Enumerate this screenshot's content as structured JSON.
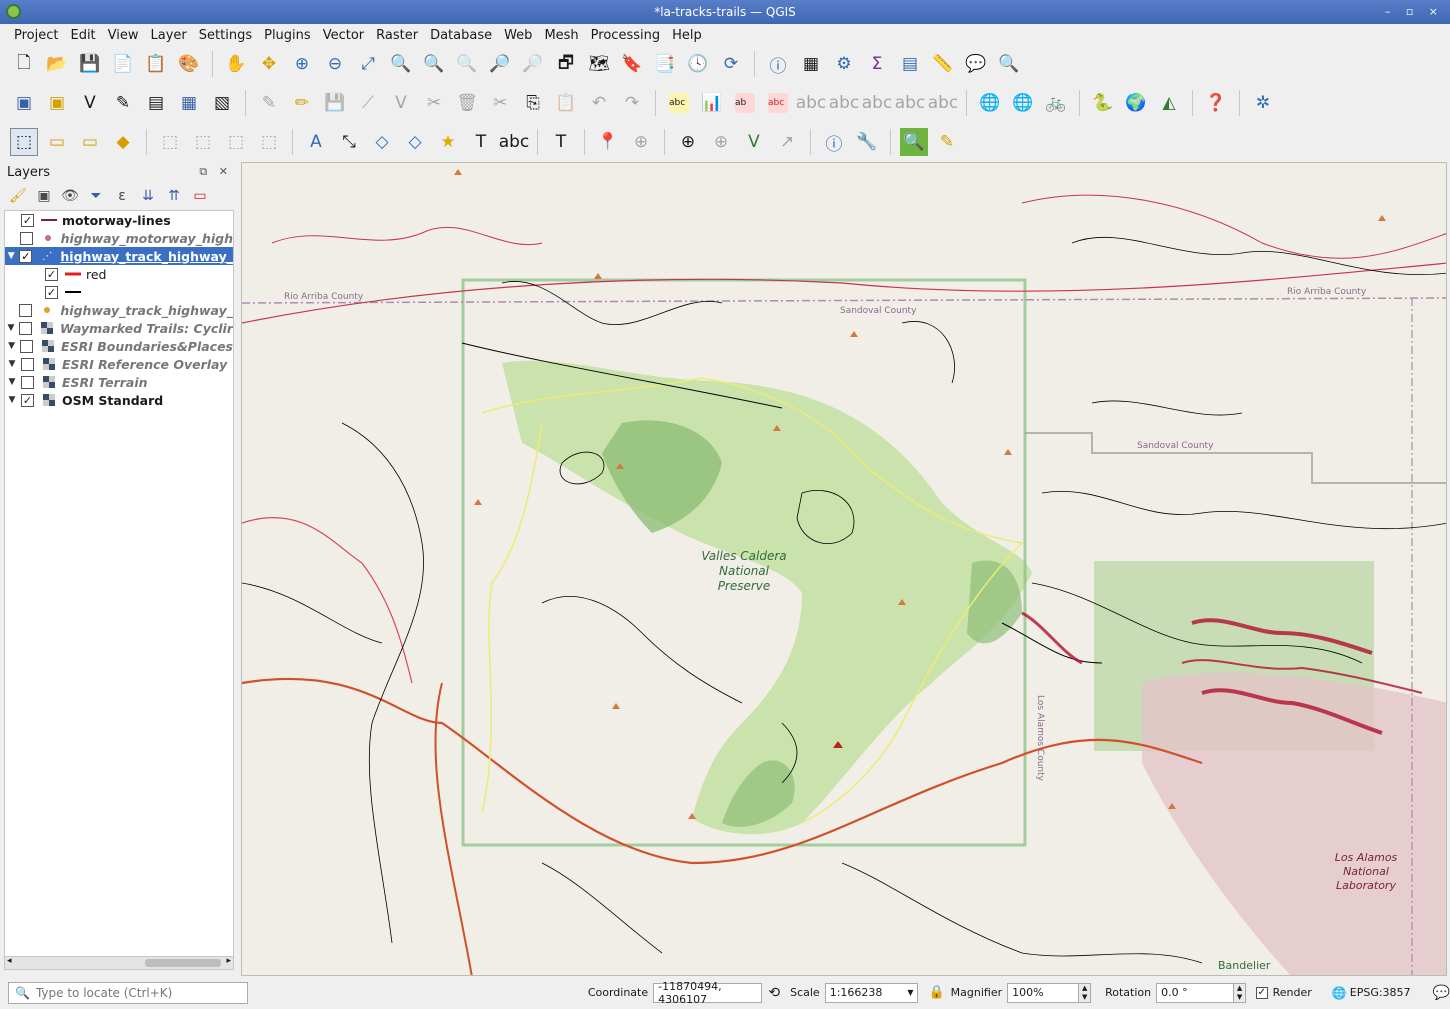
{
  "window": {
    "title": "*la-tracks-trails — QGIS",
    "buttons": "–  ▫  ×"
  },
  "menu": [
    "Project",
    "Edit",
    "View",
    "Layer",
    "Settings",
    "Plugins",
    "Vector",
    "Raster",
    "Database",
    "Web",
    "Mesh",
    "Processing",
    "Help"
  ],
  "layers_panel": {
    "title": "Layers",
    "rows": [
      {
        "name": "motorway-lines",
        "checked": "✓",
        "style": "bold"
      },
      {
        "name": "highway_motorway_high",
        "checked": "",
        "style": "ital"
      },
      {
        "name": "highway_track_highway_",
        "checked": "✓",
        "style": "sel"
      },
      {
        "name": "red",
        "checked": "✓",
        "style": "child"
      },
      {
        "name": "",
        "checked": "✓",
        "style": "child"
      },
      {
        "name": "highway_track_highway_",
        "checked": "",
        "style": "ital"
      },
      {
        "name": "Waymarked Trails: Cyclir",
        "checked": "",
        "style": "ital"
      },
      {
        "name": "ESRI Boundaries&Places",
        "checked": "",
        "style": "ital"
      },
      {
        "name": "ESRI Reference Overlay",
        "checked": "",
        "style": "ital"
      },
      {
        "name": "ESRI Terrain",
        "checked": "",
        "style": "ital"
      },
      {
        "name": "OSM Standard",
        "checked": "✓",
        "style": "bold"
      }
    ]
  },
  "map": {
    "labels": {
      "rio_arriba_w": "Rio Arriba County",
      "rio_arriba_e": "Rio Arriba County",
      "sandoval_n": "Sandoval County",
      "sandoval_e": "Sandoval County",
      "los_alamos_county": "Los Alamos County",
      "valles_caldera": "Valles Caldera National Preserve",
      "lanl": "Los Alamos National Laboratory",
      "bandelier": "Bandelier"
    }
  },
  "status": {
    "locate_placeholder": "Type to locate (Ctrl+K)",
    "coordinate_label": "Coordinate",
    "coordinate_value": "-11870494, 4306107",
    "scale_label": "Scale",
    "scale_value": "1:166238",
    "magnifier_label": "Magnifier",
    "magnifier_value": "100%",
    "rotation_label": "Rotation",
    "rotation_value": "0.0 °",
    "render_label": "Render",
    "crs": "EPSG:3857"
  }
}
